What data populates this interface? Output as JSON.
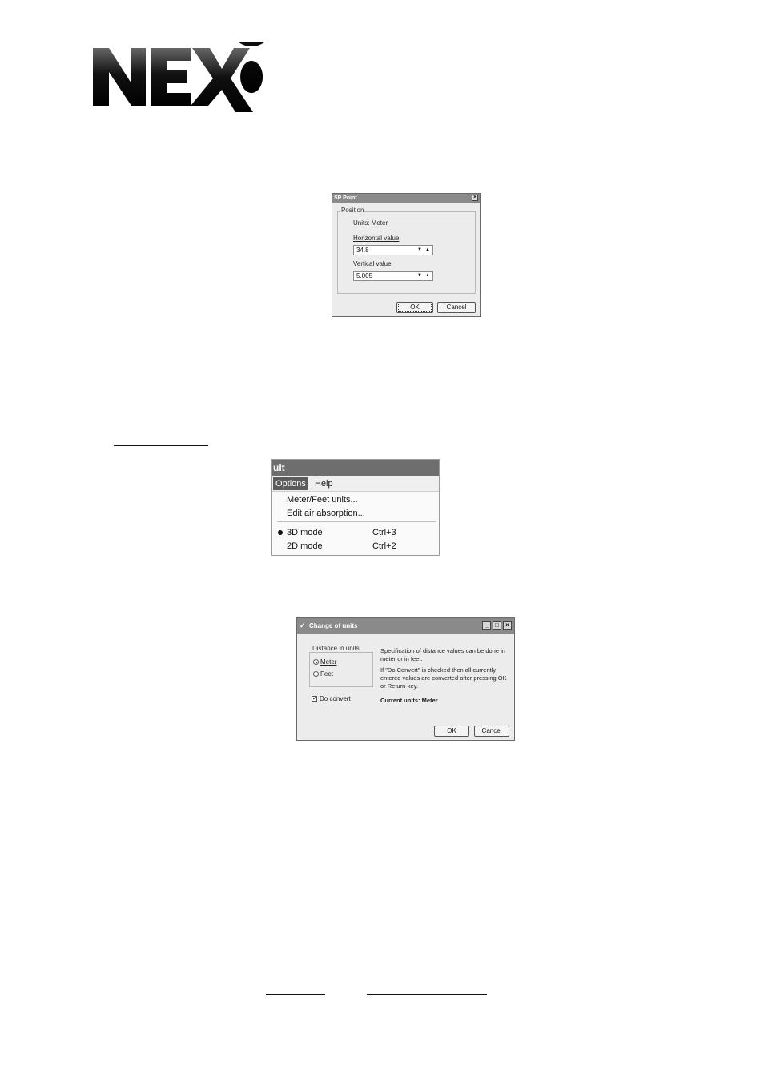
{
  "logo": {
    "text": "NEXO"
  },
  "sp_point_dialog": {
    "title": "SP Point",
    "close_glyph": "×",
    "group_title": "Position",
    "units_label": "Units: Meter",
    "horizontal_label": "Horizontal value",
    "horizontal_value": "34.8",
    "vertical_label": "Vertical value",
    "vertical_value": "5.005",
    "spin_down": "▼",
    "spin_up": "▲",
    "ok_label": "OK",
    "cancel_label": "Cancel"
  },
  "menu_screenshot": {
    "title_fragment": "ult",
    "menubar": [
      "Options",
      "Help"
    ],
    "items": [
      {
        "label": "Meter/Feet units...",
        "shortcut": ""
      },
      {
        "label": "Edit air absorption...",
        "shortcut": ""
      },
      {
        "label": "3D mode",
        "shortcut": "Ctrl+3",
        "selected": true
      },
      {
        "label": "2D mode",
        "shortcut": "Ctrl+2"
      }
    ]
  },
  "change_units_dialog": {
    "title": "Change of units",
    "group_title": "Distance in units",
    "radio_meter": "Meter",
    "radio_feet": "Feet",
    "selected_unit": "Meter",
    "do_convert_label": "Do convert",
    "do_convert_checked": true,
    "description_1": "Specification of distance values can be done in meter or in feet.",
    "description_2": "If \"Do Convert\" is checked then all currently entered values are converted after pressing OK or Return-key.",
    "current_units": "Current units: Meter",
    "ok_label": "OK",
    "cancel_label": "Cancel",
    "minimize_glyph": "_",
    "maximize_glyph": "□",
    "close_glyph": "×"
  }
}
